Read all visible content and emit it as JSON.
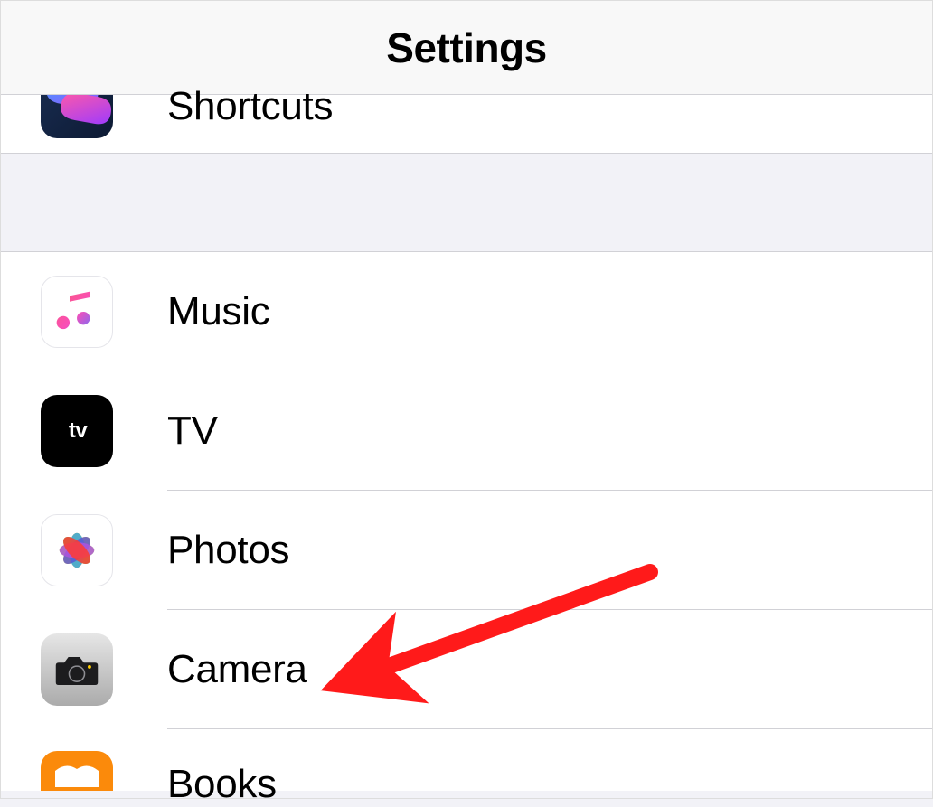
{
  "header": {
    "title": "Settings"
  },
  "rows": {
    "shortcuts": {
      "label": "Shortcuts"
    },
    "music": {
      "label": "Music"
    },
    "tv": {
      "label": "TV"
    },
    "photos": {
      "label": "Photos"
    },
    "camera": {
      "label": "Camera"
    },
    "books": {
      "label": "Books"
    }
  },
  "annotation": {
    "target": "camera"
  }
}
